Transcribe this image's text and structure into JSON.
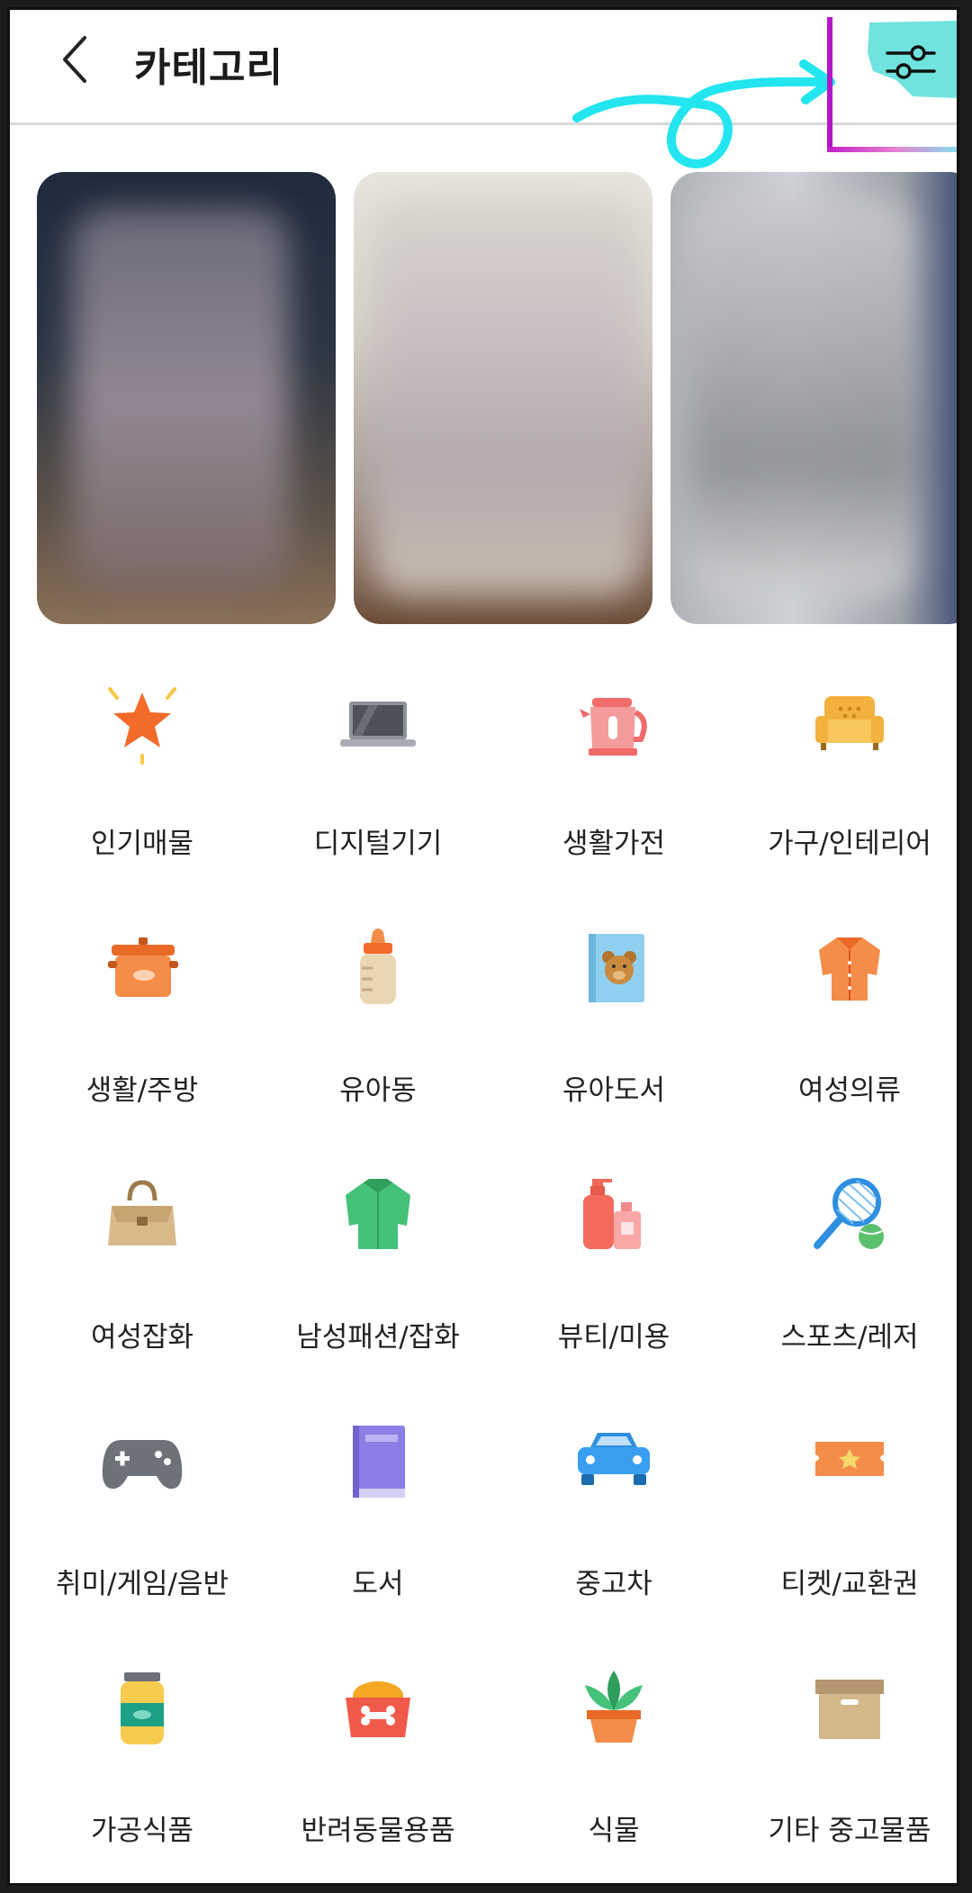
{
  "header": {
    "title": "카테고리",
    "back_icon": "chevron-left-icon",
    "filter_icon": "sliders-icon"
  },
  "banner": {
    "cards": [
      {
        "name": "banner-card-1"
      },
      {
        "name": "banner-card-2"
      },
      {
        "name": "banner-card-3"
      }
    ]
  },
  "categories": [
    {
      "label": "인기매물",
      "icon": "star-icon"
    },
    {
      "label": "디지털기기",
      "icon": "laptop-icon"
    },
    {
      "label": "생활가전",
      "icon": "kettle-icon"
    },
    {
      "label": "가구/인테리어",
      "icon": "sofa-icon"
    },
    {
      "label": "생활/주방",
      "icon": "pot-icon"
    },
    {
      "label": "유아동",
      "icon": "baby-bottle-icon"
    },
    {
      "label": "유아도서",
      "icon": "bear-book-icon"
    },
    {
      "label": "여성의류",
      "icon": "blouse-icon"
    },
    {
      "label": "여성잡화",
      "icon": "handbag-icon"
    },
    {
      "label": "남성패션/잡화",
      "icon": "shirt-icon"
    },
    {
      "label": "뷰티/미용",
      "icon": "cosmetics-icon"
    },
    {
      "label": "스포츠/레저",
      "icon": "tennis-icon"
    },
    {
      "label": "취미/게임/음반",
      "icon": "gamepad-icon"
    },
    {
      "label": "도서",
      "icon": "book-icon"
    },
    {
      "label": "중고차",
      "icon": "car-icon"
    },
    {
      "label": "티켓/교환권",
      "icon": "ticket-icon"
    },
    {
      "label": "가공식품",
      "icon": "jar-icon"
    },
    {
      "label": "반려동물용품",
      "icon": "pet-bowl-icon"
    },
    {
      "label": "식물",
      "icon": "plant-icon"
    },
    {
      "label": "기타 중고물품",
      "icon": "box-icon"
    }
  ],
  "colors": {
    "accent_cyan": "#22e5ef",
    "accent_magenta": "#c21fc8",
    "divider": "#d9d9d9"
  }
}
